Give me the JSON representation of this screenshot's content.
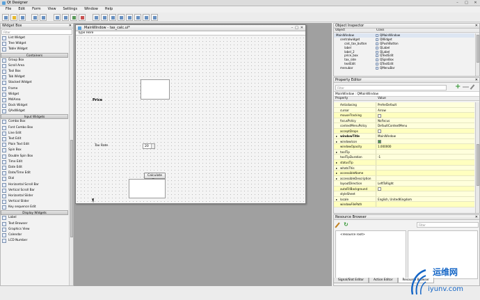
{
  "window": {
    "title": "Qt Designer",
    "min": "–",
    "max": "□",
    "close": "✕"
  },
  "menu": [
    "File",
    "Edit",
    "Form",
    "View",
    "Settings",
    "Window",
    "Help"
  ],
  "widget_box": {
    "title": "Widget Box",
    "filter_placeholder": "Filter",
    "items": [
      {
        "type": "item",
        "label": "List Widget"
      },
      {
        "type": "item",
        "label": "Tree Widget"
      },
      {
        "type": "item",
        "label": "Table Widget"
      },
      {
        "type": "cat",
        "label": "Containers"
      },
      {
        "type": "item",
        "label": "Group Box"
      },
      {
        "type": "item",
        "label": "Scroll Area"
      },
      {
        "type": "item",
        "label": "Tool Box"
      },
      {
        "type": "item",
        "label": "Tab Widget"
      },
      {
        "type": "item",
        "label": "Stacked Widget"
      },
      {
        "type": "item",
        "label": "Frame"
      },
      {
        "type": "item",
        "label": "Widget"
      },
      {
        "type": "item",
        "label": "MdiArea"
      },
      {
        "type": "item",
        "label": "Dock Widget"
      },
      {
        "type": "item",
        "label": "QAxWidget"
      },
      {
        "type": "cat",
        "label": "Input Widgets"
      },
      {
        "type": "item",
        "label": "Combo Box"
      },
      {
        "type": "item",
        "label": "Font Combo Box"
      },
      {
        "type": "item",
        "label": "Line Edit"
      },
      {
        "type": "item",
        "label": "Text Edit"
      },
      {
        "type": "item",
        "label": "Plain Text Edit"
      },
      {
        "type": "item",
        "label": "Spin Box"
      },
      {
        "type": "item",
        "label": "Double Spin Box"
      },
      {
        "type": "item",
        "label": "Time Edit"
      },
      {
        "type": "item",
        "label": "Date Edit"
      },
      {
        "type": "item",
        "label": "Date/Time Edit"
      },
      {
        "type": "item",
        "label": "Dial"
      },
      {
        "type": "item",
        "label": "Horizontal Scroll Bar"
      },
      {
        "type": "item",
        "label": "Vertical Scroll Bar"
      },
      {
        "type": "item",
        "label": "Horizontal Slider"
      },
      {
        "type": "item",
        "label": "Vertical Slider"
      },
      {
        "type": "item",
        "label": "Key sequence Edit"
      },
      {
        "type": "cat",
        "label": "Display Widgets"
      },
      {
        "type": "item",
        "label": "Label"
      },
      {
        "type": "item",
        "label": "Text Browser"
      },
      {
        "type": "item",
        "label": "Graphics View"
      },
      {
        "type": "item",
        "label": "Calendar"
      },
      {
        "type": "item",
        "label": "LCD Number"
      }
    ]
  },
  "form": {
    "title": "MainWindow - tax_calc.ui*",
    "menu_placeholder": "Type Here",
    "price_label": "Price",
    "tax_rate_label": "Tax Rate",
    "spin_value": "20",
    "calc_button": "Calculate Tax"
  },
  "object_inspector": {
    "title": "Object Inspector",
    "col_object": "Object",
    "col_class": "Class",
    "rows": [
      {
        "object": "MainWindow",
        "class": "QMainWindow",
        "indent": 0
      },
      {
        "object": "centralwidget",
        "class": "QWidget",
        "indent": 1
      },
      {
        "object": "calc_tax_button",
        "class": "QPushButton",
        "indent": 2
      },
      {
        "object": "label",
        "class": "QLabel",
        "indent": 2
      },
      {
        "object": "label_2",
        "class": "QLabel",
        "indent": 2
      },
      {
        "object": "price_box",
        "class": "QTextEdit",
        "indent": 2
      },
      {
        "object": "tax_rate",
        "class": "QSpinBox",
        "indent": 2
      },
      {
        "object": "textEdit",
        "class": "QTextEdit",
        "indent": 2
      },
      {
        "object": "menubar",
        "class": "QMenuBar",
        "indent": 1
      }
    ]
  },
  "property_editor": {
    "title": "Property Editor",
    "filter_placeholder": "Filter",
    "object_label": "MainWindow : QMainWindow",
    "col_property": "Property",
    "col_value": "Value",
    "rows": [
      {
        "name": "Antialiasing",
        "value": "PreferDefault",
        "kind": "text",
        "style": "alt",
        "expand": ""
      },
      {
        "name": "cursor",
        "value": "Arrow",
        "kind": "text",
        "style": "alt",
        "expand": ""
      },
      {
        "name": "mouseTracking",
        "value": "",
        "kind": "check",
        "style": "norm",
        "expand": ""
      },
      {
        "name": "focusPolicy",
        "value": "NoFocus",
        "kind": "text",
        "style": "alt",
        "expand": ""
      },
      {
        "name": "contextMenuPolicy",
        "value": "DefaultContextMenu",
        "kind": "text",
        "style": "alt",
        "expand": ""
      },
      {
        "name": "acceptDrops",
        "value": "",
        "kind": "check",
        "style": "norm",
        "expand": ""
      },
      {
        "name": "windowTitle",
        "value": "MainWindow",
        "kind": "text",
        "style": "alt",
        "expand": "▸",
        "bold": true
      },
      {
        "name": "windowIcon",
        "value": "",
        "kind": "check-on",
        "style": "alt",
        "expand": "▸"
      },
      {
        "name": "windowOpacity",
        "value": "1.000000",
        "kind": "text",
        "style": "norm",
        "expand": ""
      },
      {
        "name": "toolTip",
        "value": "",
        "kind": "text",
        "style": "alt",
        "expand": "▸"
      },
      {
        "name": "toolTipDuration",
        "value": "-1",
        "kind": "text",
        "style": "alt",
        "expand": ""
      },
      {
        "name": "statusTip",
        "value": "",
        "kind": "text",
        "style": "norm",
        "expand": "▸"
      },
      {
        "name": "whatsThis",
        "value": "",
        "kind": "text",
        "style": "alt",
        "expand": "▸"
      },
      {
        "name": "accessibleName",
        "value": "",
        "kind": "text",
        "style": "norm",
        "expand": "▸"
      },
      {
        "name": "accessibleDescription",
        "value": "",
        "kind": "text",
        "style": "alt",
        "expand": "▸"
      },
      {
        "name": "layoutDirection",
        "value": "LeftToRight",
        "kind": "text",
        "style": "alt",
        "expand": ""
      },
      {
        "name": "autoFillBackground",
        "value": "",
        "kind": "check",
        "style": "norm",
        "expand": ""
      },
      {
        "name": "styleSheet",
        "value": "",
        "kind": "text",
        "style": "alt",
        "expand": ""
      },
      {
        "name": "locale",
        "value": "English, UnitedKingdom",
        "kind": "text",
        "style": "alt",
        "expand": "▸"
      },
      {
        "name": "windowFilePath",
        "value": "",
        "kind": "text",
        "style": "norm",
        "expand": ""
      }
    ]
  },
  "resource_browser": {
    "title": "Resource Browser",
    "filter_placeholder": "Filter",
    "root_item": "<resource root>"
  },
  "bottom_tabs": [
    "Signal/Slot Editor",
    "Action Editor",
    "Resource Browser"
  ],
  "watermark": {
    "line1": "运维网",
    "line2": "iyunv.com"
  }
}
